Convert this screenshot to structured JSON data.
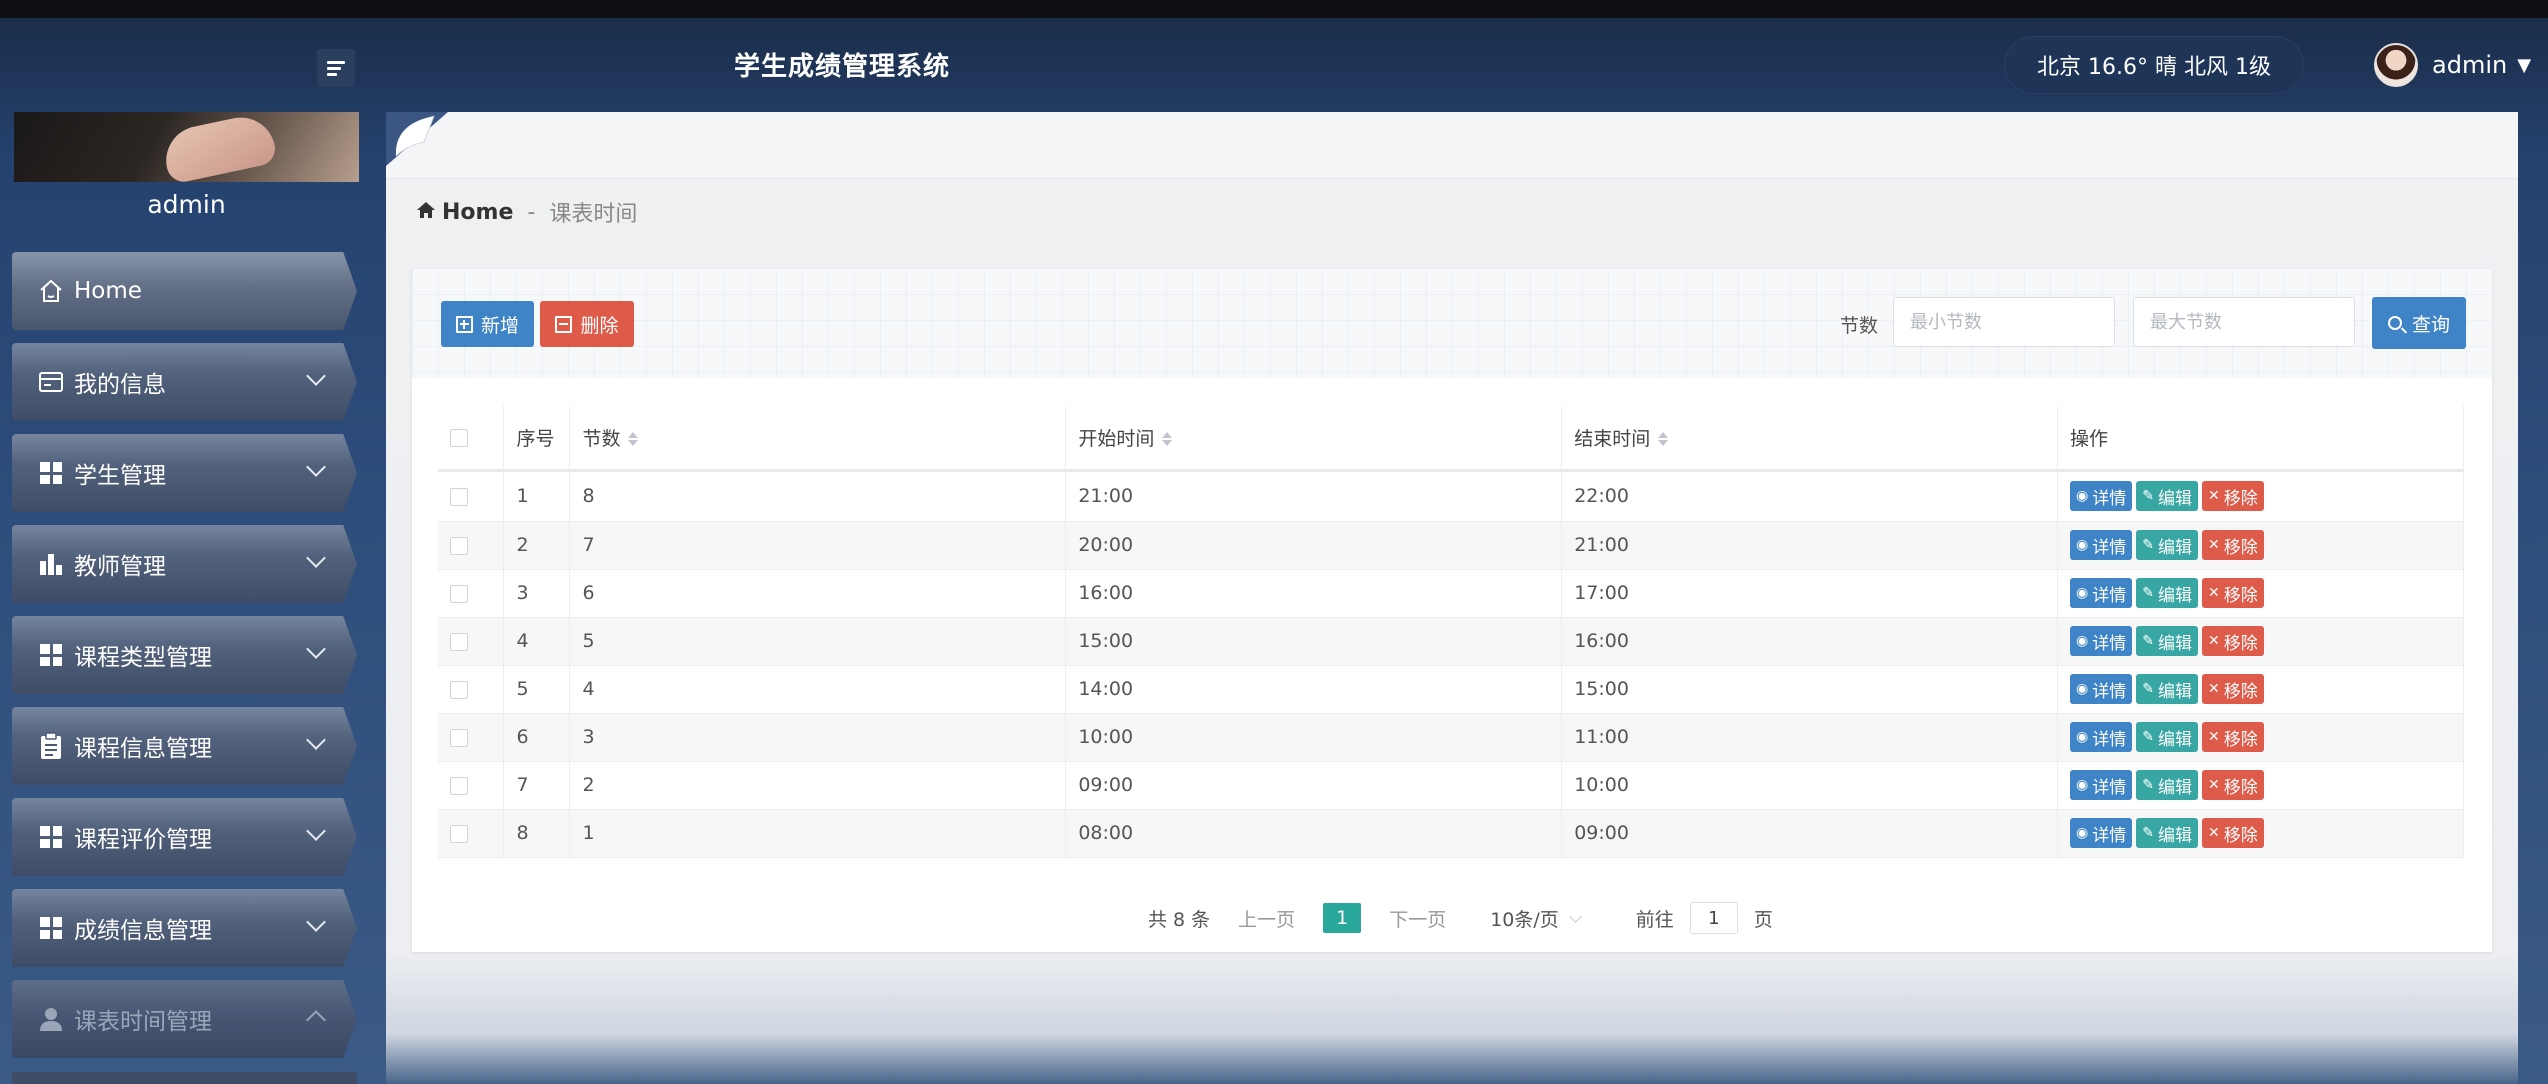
{
  "header": {
    "app_title": "学生成绩管理系统",
    "weather": "北京  16.6°  晴  北风  1级",
    "user_name": "admin"
  },
  "sidebar": {
    "profile_name": "admin",
    "items": [
      {
        "label": "Home",
        "icon": "home-icon"
      },
      {
        "label": "我的信息",
        "icon": "id-card-icon"
      },
      {
        "label": "学生管理",
        "icon": "grid-icon"
      },
      {
        "label": "教师管理",
        "icon": "bar-chart-icon"
      },
      {
        "label": "课程类型管理",
        "icon": "grid-icon"
      },
      {
        "label": "课程信息管理",
        "icon": "clipboard-icon"
      },
      {
        "label": "课程评价管理",
        "icon": "grid-icon"
      },
      {
        "label": "成绩信息管理",
        "icon": "grid-icon"
      },
      {
        "label": "课表时间管理",
        "icon": "user-icon"
      }
    ]
  },
  "breadcrumb": {
    "home": "Home",
    "separator": "-",
    "current": "课表时间"
  },
  "toolbar": {
    "add_label": "新增",
    "delete_label": "删除",
    "filter_label": "节数",
    "min_placeholder": "最小节数",
    "max_placeholder": "最大节数",
    "search_label": "查询"
  },
  "table": {
    "columns": [
      "序号",
      "节数",
      "开始时间",
      "结束时间",
      "操作"
    ],
    "rows": [
      {
        "index": "1",
        "period": "8",
        "start": "21:00",
        "end": "22:00"
      },
      {
        "index": "2",
        "period": "7",
        "start": "20:00",
        "end": "21:00"
      },
      {
        "index": "3",
        "period": "6",
        "start": "16:00",
        "end": "17:00"
      },
      {
        "index": "4",
        "period": "5",
        "start": "15:00",
        "end": "16:00"
      },
      {
        "index": "5",
        "period": "4",
        "start": "14:00",
        "end": "15:00"
      },
      {
        "index": "6",
        "period": "3",
        "start": "10:00",
        "end": "11:00"
      },
      {
        "index": "7",
        "period": "2",
        "start": "09:00",
        "end": "10:00"
      },
      {
        "index": "8",
        "period": "1",
        "start": "08:00",
        "end": "09:00"
      }
    ],
    "actions": {
      "detail": "详情",
      "edit": "编辑",
      "remove": "移除"
    }
  },
  "pagination": {
    "total": "共 8 条",
    "prev": "上一页",
    "current_page": "1",
    "next": "下一页",
    "page_size": "10条/页",
    "goto_prefix": "前往",
    "goto_value": "1",
    "goto_suffix": "页"
  },
  "colors": {
    "primary": "#3f84c7",
    "danger": "#de5b4a",
    "success": "#38a6a2",
    "page_active": "#2aa79b"
  }
}
